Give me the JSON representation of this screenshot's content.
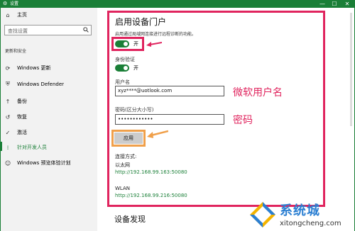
{
  "window": {
    "title": "设置",
    "min": "—",
    "max": "☐",
    "close": "✕"
  },
  "sidebar": {
    "home": "主页",
    "search_placeholder": "查找设置",
    "section": "更新和安全",
    "items": [
      {
        "label": "Windows 更新",
        "icon": "refresh-icon"
      },
      {
        "label": "Windows Defender",
        "icon": "shield-icon"
      },
      {
        "label": "备份",
        "icon": "backup-icon"
      },
      {
        "label": "恢复",
        "icon": "recovery-icon"
      },
      {
        "label": "激活",
        "icon": "activation-icon"
      },
      {
        "label": "针对开发人员",
        "icon": "developer-icon"
      },
      {
        "label": "Windows 预览体验计划",
        "icon": "insider-icon"
      }
    ],
    "selected_index": 5
  },
  "main": {
    "title": "启用设备门户",
    "description": "启用通过局域网连接进行远程诊断的功能。",
    "portal_toggle": {
      "state": "开",
      "on": true
    },
    "auth_label": "身份验证",
    "auth_toggle": {
      "state": "开",
      "on": true
    },
    "username_label": "用户名",
    "username_value": "xyz****@uotlook.com",
    "password_label": "密码(区分大小写)",
    "password_value": "••••••••••••",
    "apply_label": "应用",
    "connection_label": "连接方式:",
    "ethernet_label": "以太网",
    "ethernet_url": "http://192.168.99.163:50080",
    "wlan_label": "WLAN",
    "wlan_url": "http://192.168.99.216:50080",
    "next_section": "设备发现"
  },
  "annotations": {
    "username_note": "微软用户名",
    "password_note": "密码"
  },
  "watermark": {
    "brand": "系统城",
    "url": "xitongcheng.com"
  },
  "colors": {
    "accent": "#1a7f37",
    "highlight_red": "#e0245e",
    "highlight_orange": "#f0a04b",
    "watermark_blue": "#2b7fd2"
  }
}
